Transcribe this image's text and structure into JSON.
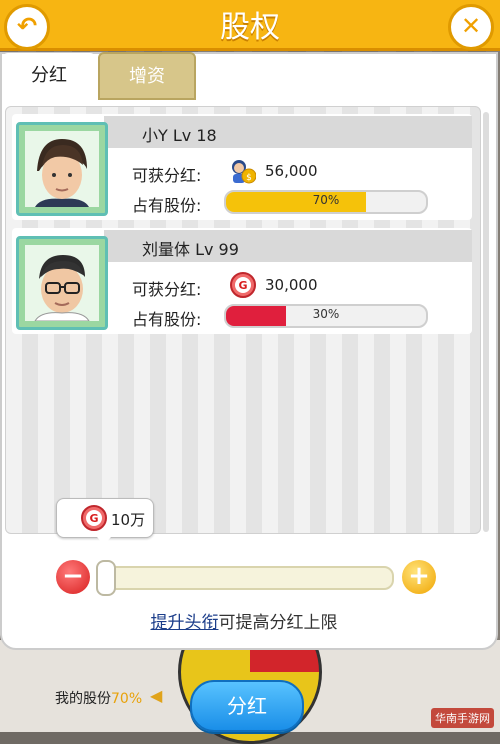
{
  "header": {
    "title": "股权"
  },
  "tabs": [
    {
      "label": "分红"
    },
    {
      "label": "增资"
    }
  ],
  "shareholders": [
    {
      "name": "小Y",
      "level": "Lv 18",
      "name_line": "小Y  Lv 18",
      "dividend_label": "可获分红:",
      "dividend_value": "56,000",
      "dividend_icon": "character-coin-icon",
      "share_label": "占有股份:",
      "share_percent_text": "70%",
      "share_fraction": 0.7,
      "bar_color": "#f5c20a"
    },
    {
      "name": "刘量体",
      "level": "Lv 99",
      "name_line": "刘量体  Lv 99",
      "dividend_label": "可获分红:",
      "dividend_value": "30,000",
      "dividend_icon": "red-g-coin-icon",
      "share_label": "占有股份:",
      "share_percent_text": "30%",
      "share_fraction": 0.3,
      "bar_color": "#e01f3d"
    }
  ],
  "slider": {
    "tooltip_value": "10万",
    "level_fraction": 0.0
  },
  "hint": {
    "link": "提升头衔",
    "text": "可提高分红上限"
  },
  "footer": {
    "my_shares_label": "我的股份",
    "my_shares_value": "70%",
    "divide_button": "分红"
  },
  "watermark": "华南手游网",
  "colors": {
    "header": "#f7b512",
    "accent": "#1a8ee8"
  }
}
